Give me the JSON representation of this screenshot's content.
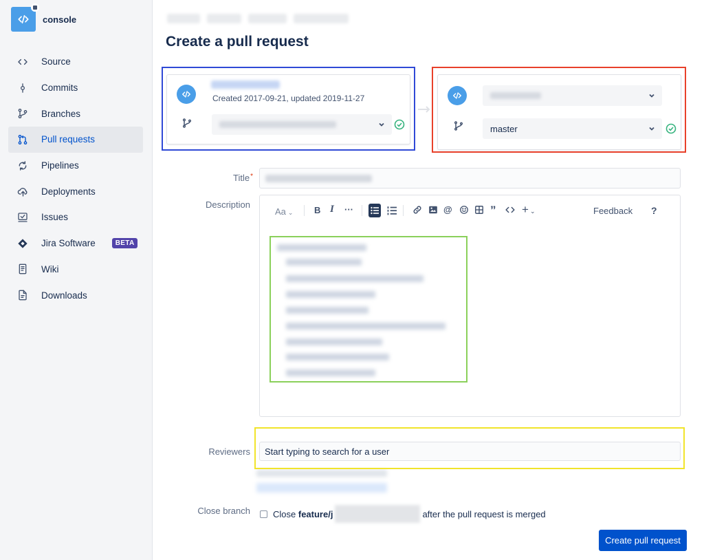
{
  "repo": {
    "name": "console",
    "icon": "code-icon"
  },
  "sidebar": {
    "items": [
      {
        "label": "Source",
        "icon": "code-icon"
      },
      {
        "label": "Commits",
        "icon": "commit-icon"
      },
      {
        "label": "Branches",
        "icon": "branch-icon"
      },
      {
        "label": "Pull requests",
        "icon": "pull-request-icon",
        "active": true
      },
      {
        "label": "Pipelines",
        "icon": "pipelines-icon"
      },
      {
        "label": "Deployments",
        "icon": "cloud-upload-icon"
      },
      {
        "label": "Issues",
        "icon": "issues-icon"
      },
      {
        "label": "Jira Software",
        "icon": "jira-icon",
        "badge": "BETA"
      },
      {
        "label": "Wiki",
        "icon": "wiki-icon"
      },
      {
        "label": "Downloads",
        "icon": "download-icon"
      }
    ]
  },
  "page": {
    "title": "Create a pull request"
  },
  "source": {
    "created": "Created 2017-09-21, updated 2019-11-27"
  },
  "destination": {
    "branch": "master"
  },
  "form": {
    "title_label": "Title",
    "title_required": "*",
    "description_label": "Description",
    "reviewers_label": "Reviewers",
    "reviewers_placeholder": "Start typing to search for a user",
    "close_branch_label": "Close branch",
    "close_prefix": "Close",
    "close_branch_name": "feature/j",
    "close_suffix": "after the pull request is merged",
    "submit_label": "Create pull request"
  },
  "editor": {
    "text_style": "Aa",
    "more": "···",
    "feedback": "Feedback",
    "help": "?"
  },
  "colors": {
    "accent": "#0052cc",
    "repo_blue": "#4a9ee8",
    "success": "#36b37e",
    "beta": "#5243aa",
    "frame_blue": "#2f49d6",
    "frame_red": "#e8402a",
    "frame_green": "#8ad05a",
    "frame_yellow": "#f1e42a"
  }
}
